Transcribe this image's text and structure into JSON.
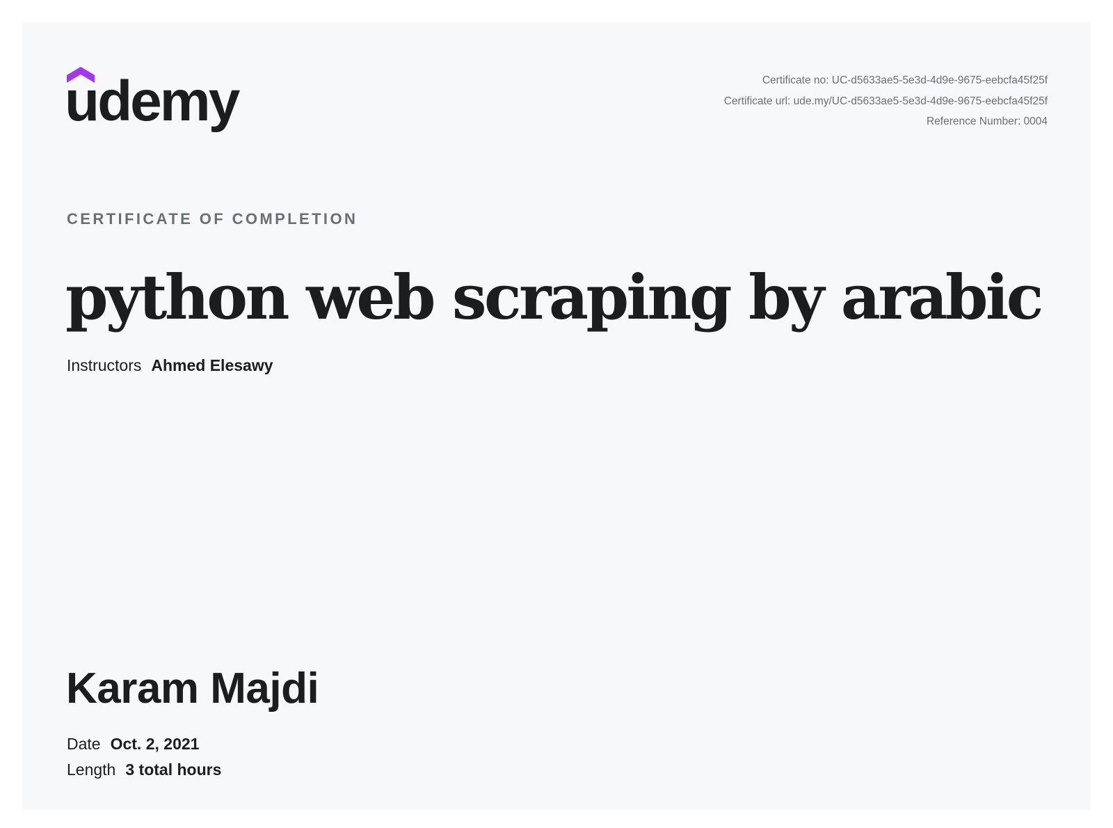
{
  "brand": {
    "logo_text": "udemy",
    "accent_color": "#a435f0",
    "text_color": "#1c1d1f"
  },
  "certificate": {
    "number_line": "Certificate no: UC-d5633ae5-5e3d-4d9e-9675-eebcfa45f25f",
    "url_line": "Certificate url: ude.my/UC-d5633ae5-5e3d-4d9e-9675-eebcfa45f25f",
    "reference_line": "Reference Number: 0004",
    "kicker": "CERTIFICATE OF COMPLETION",
    "course_title": "python web scraping by arabic",
    "instructors_label": "Instructors",
    "instructors_value": "Ahmed Elesawy",
    "recipient_name": "Karam Majdi",
    "date_label": "Date",
    "date_value": "Oct. 2, 2021",
    "length_label": "Length",
    "length_value": "3 total hours"
  }
}
